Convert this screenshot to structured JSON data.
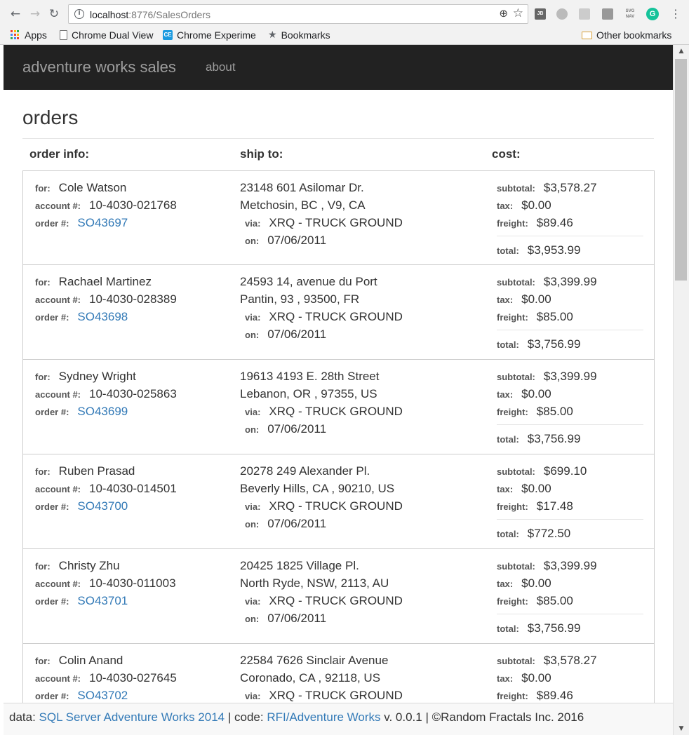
{
  "browser": {
    "url_host": "localhost",
    "url_rest": ":8776/SalesOrders",
    "extensions": [
      "JB",
      "SVG NAV",
      "G"
    ],
    "bookmarks": {
      "apps": "Apps",
      "items": [
        "Chrome Dual View",
        "Chrome Experime",
        "Bookmarks"
      ],
      "other": "Other bookmarks"
    }
  },
  "navbar": {
    "brand": "adventure works sales",
    "about": "about"
  },
  "page": {
    "title": "orders",
    "columns": {
      "order_info": "order info:",
      "ship_to": "ship to:",
      "cost": "cost:"
    }
  },
  "labels": {
    "for": "for:",
    "account": "account #:",
    "order": "order #:",
    "via": "via:",
    "on": "on:",
    "subtotal": "subtotal:",
    "tax": "tax:",
    "freight": "freight:",
    "total": "total:"
  },
  "orders": [
    {
      "customer": "Cole Watson",
      "account": "10-4030-021768",
      "order_no": "SO43697",
      "address1": "23148 601 Asilomar Dr.",
      "address2": "Metchosin, BC , V9, CA",
      "via": "XRQ - TRUCK GROUND",
      "on": "07/06/2011",
      "subtotal": "$3,578.27",
      "tax": "$0.00",
      "freight": "$89.46",
      "total": "$3,953.99"
    },
    {
      "customer": "Rachael Martinez",
      "account": "10-4030-028389",
      "order_no": "SO43698",
      "address1": "24593 14, avenue du Port",
      "address2": "Pantin, 93 , 93500, FR",
      "via": "XRQ - TRUCK GROUND",
      "on": "07/06/2011",
      "subtotal": "$3,399.99",
      "tax": "$0.00",
      "freight": "$85.00",
      "total": "$3,756.99"
    },
    {
      "customer": "Sydney Wright",
      "account": "10-4030-025863",
      "order_no": "SO43699",
      "address1": "19613 4193 E. 28th Street",
      "address2": "Lebanon, OR , 97355, US",
      "via": "XRQ - TRUCK GROUND",
      "on": "07/06/2011",
      "subtotal": "$3,399.99",
      "tax": "$0.00",
      "freight": "$85.00",
      "total": "$3,756.99"
    },
    {
      "customer": "Ruben Prasad",
      "account": "10-4030-014501",
      "order_no": "SO43700",
      "address1": "20278 249 Alexander Pl.",
      "address2": "Beverly Hills, CA , 90210, US",
      "via": "XRQ - TRUCK GROUND",
      "on": "07/06/2011",
      "subtotal": "$699.10",
      "tax": "$0.00",
      "freight": "$17.48",
      "total": "$772.50"
    },
    {
      "customer": "Christy Zhu",
      "account": "10-4030-011003",
      "order_no": "SO43701",
      "address1": "20425 1825 Village Pl.",
      "address2": "North Ryde, NSW, 2113, AU",
      "via": "XRQ - TRUCK GROUND",
      "on": "07/06/2011",
      "subtotal": "$3,399.99",
      "tax": "$0.00",
      "freight": "$85.00",
      "total": "$3,756.99"
    },
    {
      "customer": "Colin Anand",
      "account": "10-4030-027645",
      "order_no": "SO43702",
      "address1": "22584 7626 Sinclair Avenue",
      "address2": "Coronado, CA , 92118, US",
      "via": "XRQ - TRUCK GROUND",
      "on": "",
      "subtotal": "$3,578.27",
      "tax": "$0.00",
      "freight": "$89.46",
      "total": ""
    }
  ],
  "footer": {
    "data_prefix": "data: ",
    "data_link": "SQL Server Adventure Works 2014",
    "code_prefix": " | code: ",
    "code_link": "RFI/Adventure Works",
    "suffix": " v. 0.0.1 | ©Random Fractals Inc. 2016"
  }
}
